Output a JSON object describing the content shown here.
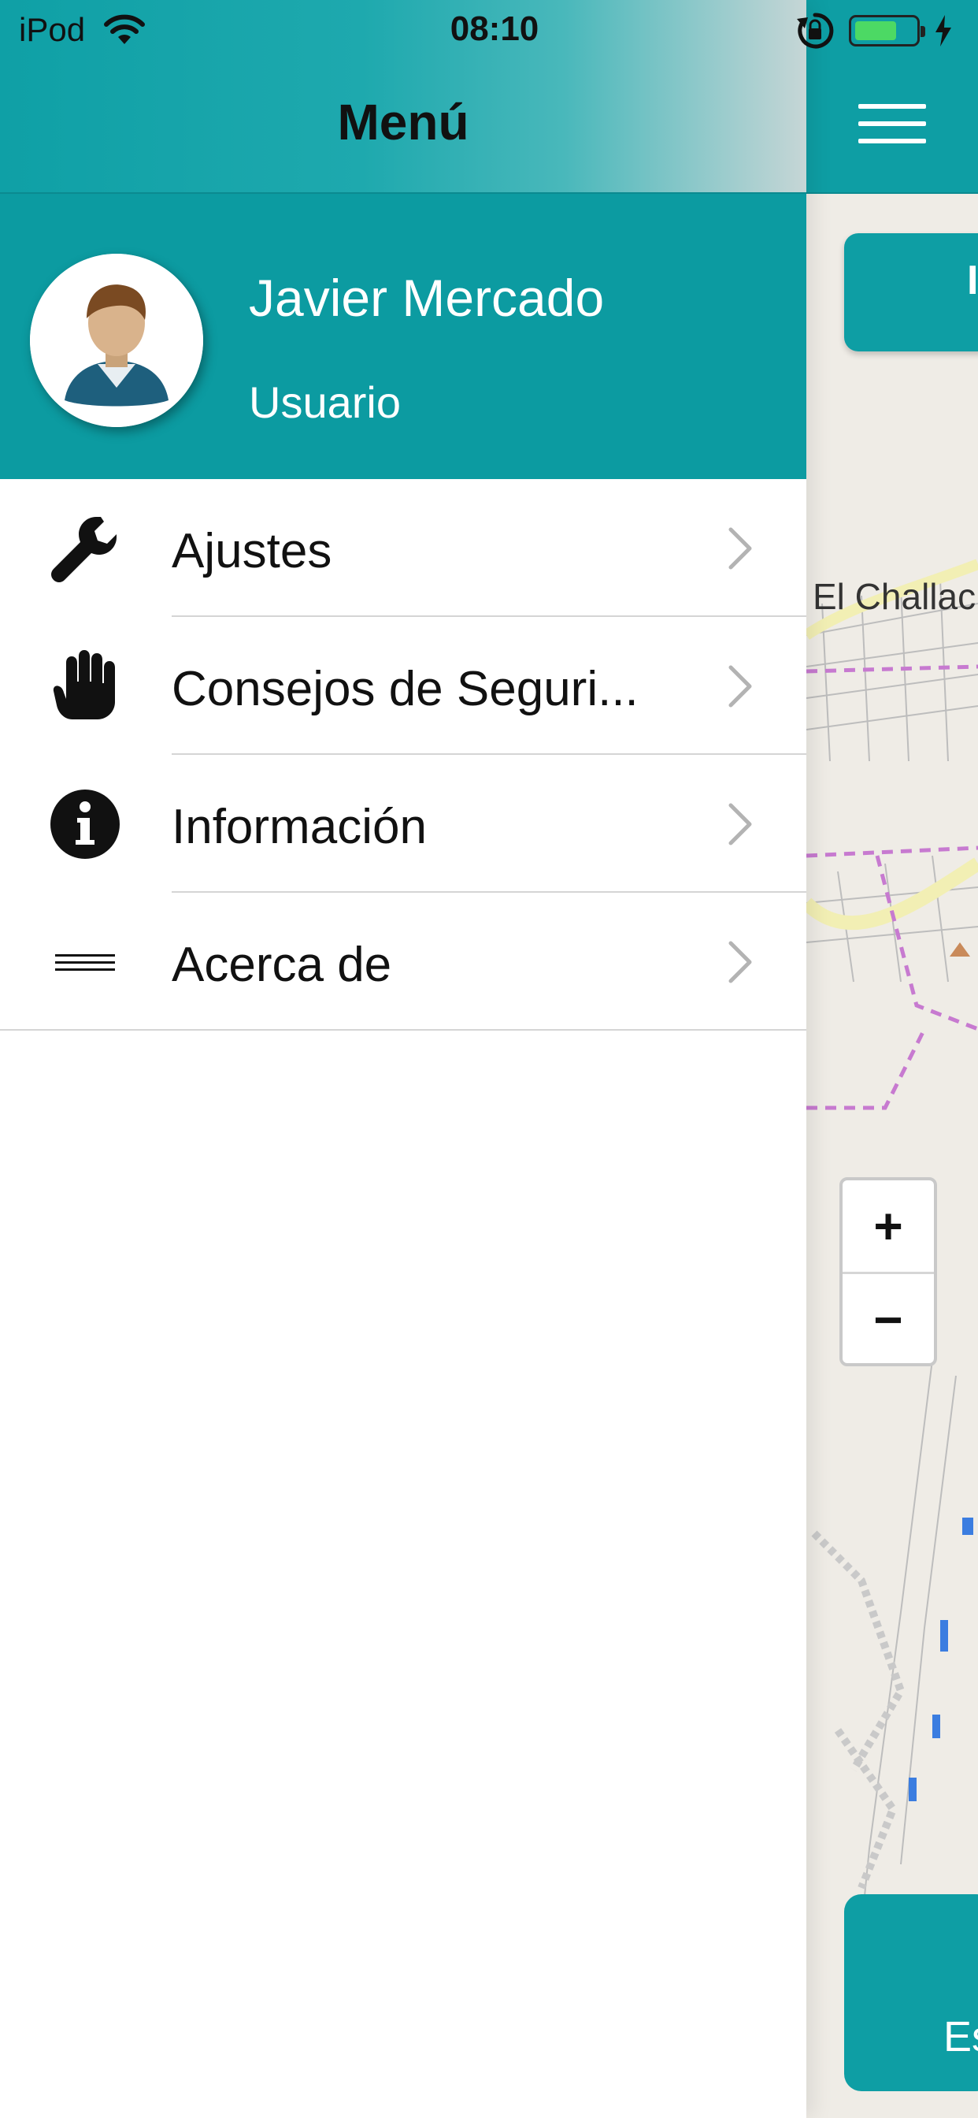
{
  "status_bar": {
    "carrier": "iPod",
    "time": "08:10"
  },
  "drawer": {
    "title": "Menú",
    "profile": {
      "name": "Javier Mercado",
      "role": "Usuario"
    },
    "items": [
      {
        "label": "Ajustes",
        "icon": "wrench-icon"
      },
      {
        "label": "Consejos de Seguri...",
        "icon": "hand-stop-icon"
      },
      {
        "label": "Información",
        "icon": "info-icon"
      },
      {
        "label": "Acerca de",
        "icon": "lines-icon"
      }
    ]
  },
  "map": {
    "place_label": "El Challac",
    "zoom_in": "+",
    "zoom_out": "−",
    "top_card_glyph": "I",
    "bottom_card_text": "Es"
  },
  "colors": {
    "accent": "#0e9ea4",
    "battery": "#4cd964"
  }
}
